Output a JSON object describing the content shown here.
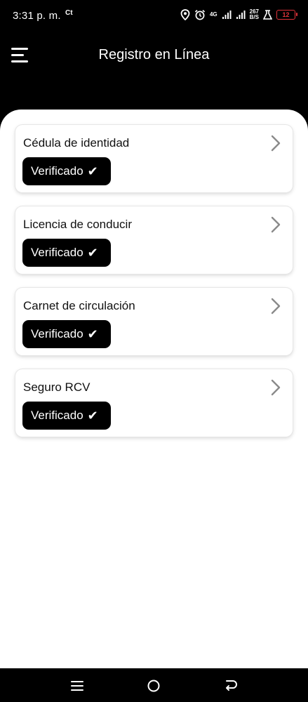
{
  "status_bar": {
    "time": "3:31 p. m.",
    "notification": "Ct",
    "network_type": "4G",
    "speed_value": "267",
    "speed_unit": "B/S",
    "battery": "12"
  },
  "header": {
    "title": "Registro en Línea"
  },
  "documents": [
    {
      "title": "Cédula de identidad",
      "status": "Verificado",
      "check": "✔"
    },
    {
      "title": "Licencia de conducir",
      "status": "Verificado",
      "check": "✔"
    },
    {
      "title": "Carnet de circulación",
      "status": "Verificado",
      "check": "✔"
    },
    {
      "title": "Seguro RCV",
      "status": "Verificado",
      "check": "✔"
    }
  ],
  "colors": {
    "background": "#000000",
    "panel": "#ffffff",
    "badge": "#000000",
    "chevron": "#8a8a8a",
    "battery_low": "#e0333a"
  },
  "icons": [
    "menu-icon",
    "location-icon",
    "alarm-icon",
    "signal-icon",
    "lab-icon",
    "battery-icon",
    "chevron-right-icon",
    "recent-apps-icon",
    "home-icon",
    "back-icon"
  ]
}
